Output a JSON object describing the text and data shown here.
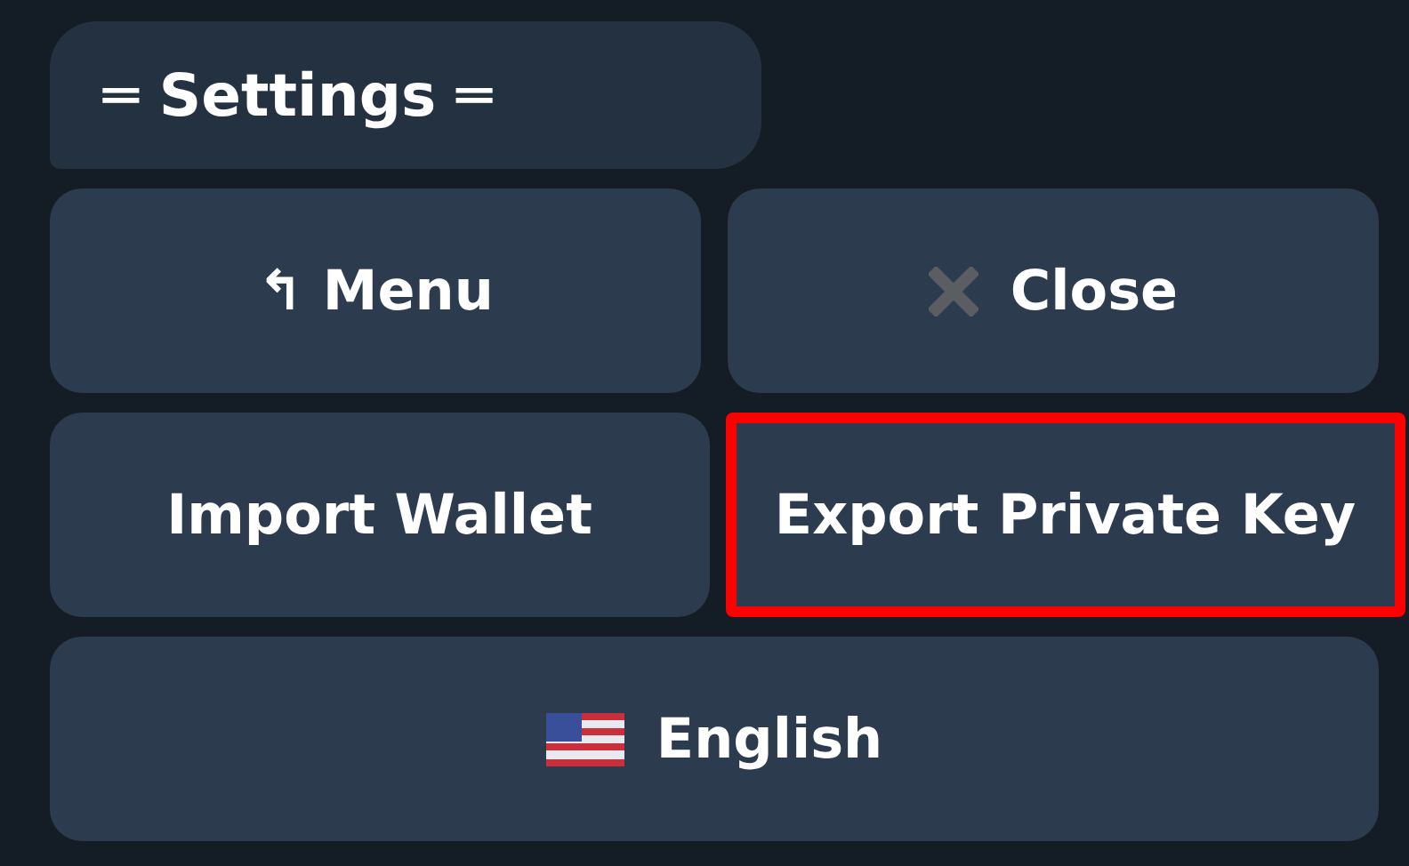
{
  "message": {
    "text": "═ Settings ═"
  },
  "keyboard": {
    "rows": [
      [
        {
          "kind": "plain",
          "label": "↰ Menu",
          "highlighted": false
        },
        {
          "kind": "close",
          "label": "Close",
          "highlighted": false
        }
      ],
      [
        {
          "kind": "plain",
          "label": "Import Wallet",
          "highlighted": false
        },
        {
          "kind": "plain",
          "label": "Export Private Key",
          "highlighted": true
        }
      ],
      [
        {
          "kind": "flag",
          "label": "English",
          "highlighted": false
        }
      ]
    ]
  }
}
